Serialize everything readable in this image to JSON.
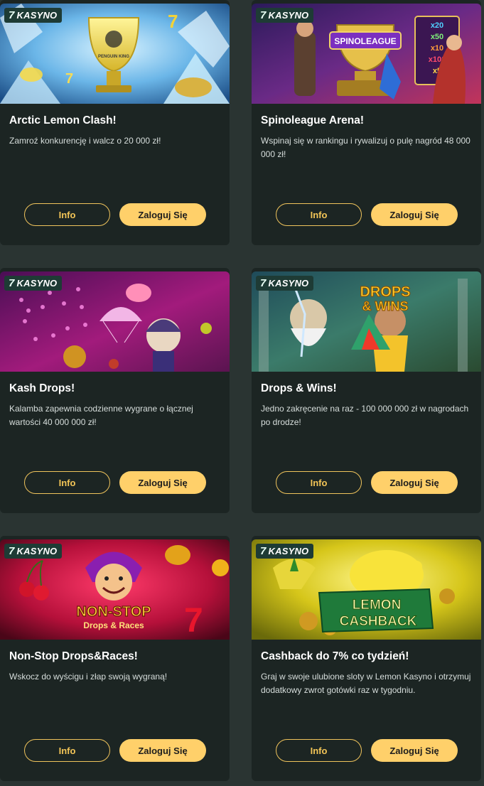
{
  "badge_label": "KASYNO",
  "badge_glyph": "7",
  "colors": {
    "page_bg": "#2a3432",
    "card_bg": "#1c2523",
    "badge_bg": "#1e3b35",
    "accent": "#ffd06a",
    "info_border": "#f0c45c"
  },
  "promotions": [
    {
      "title": "Arctic Lemon Clash!",
      "description": "Zamroź konkurencję i walcz o 20 000 zł!",
      "banner_text": "PENGUIN KING",
      "info_label": "Info",
      "login_label": "Zaloguj Się"
    },
    {
      "title": "Spinoleague Arena!",
      "description": "Wspinaj się w rankingu i rywalizuj o pulę nagród 48 000 000 zł!",
      "banner_text": "SPINOLEAGUE",
      "banner_multipliers": [
        "x20",
        "x50",
        "x10",
        "x100",
        "x5"
      ],
      "info_label": "Info",
      "login_label": "Zaloguj Się"
    },
    {
      "title": "Kash Drops!",
      "description": "Kalamba zapewnia codzienne wygrane o łącznej wartości 40 000 000 zł!",
      "info_label": "Info",
      "login_label": "Zaloguj Się"
    },
    {
      "title": "Drops & Wins!",
      "description": "Jedno zakręcenie na raz - 100 000 000 zł w nagrodach po drodze!",
      "banner_text_line1": "DROPS",
      "banner_text_line2": "& WINS",
      "info_label": "Info",
      "login_label": "Zaloguj Się"
    },
    {
      "title": "Non-Stop Drops&Races!",
      "description": "Wskocz do wyścigu i złap swoją wygraną!",
      "banner_text_line1": "NON-STOP",
      "banner_text_line2": "Drops & Races",
      "info_label": "Info",
      "login_label": "Zaloguj Się"
    },
    {
      "title": "Cashback do 7% co tydzień!",
      "description": "Graj w swoje ulubione sloty w Lemon Kasyno i otrzymuj dodatkowy zwrot gotówki raz w tygodniu.",
      "banner_text_line1": "LEMON",
      "banner_text_line2": "CASHBACK",
      "info_label": "Info",
      "login_label": "Zaloguj Się"
    }
  ]
}
